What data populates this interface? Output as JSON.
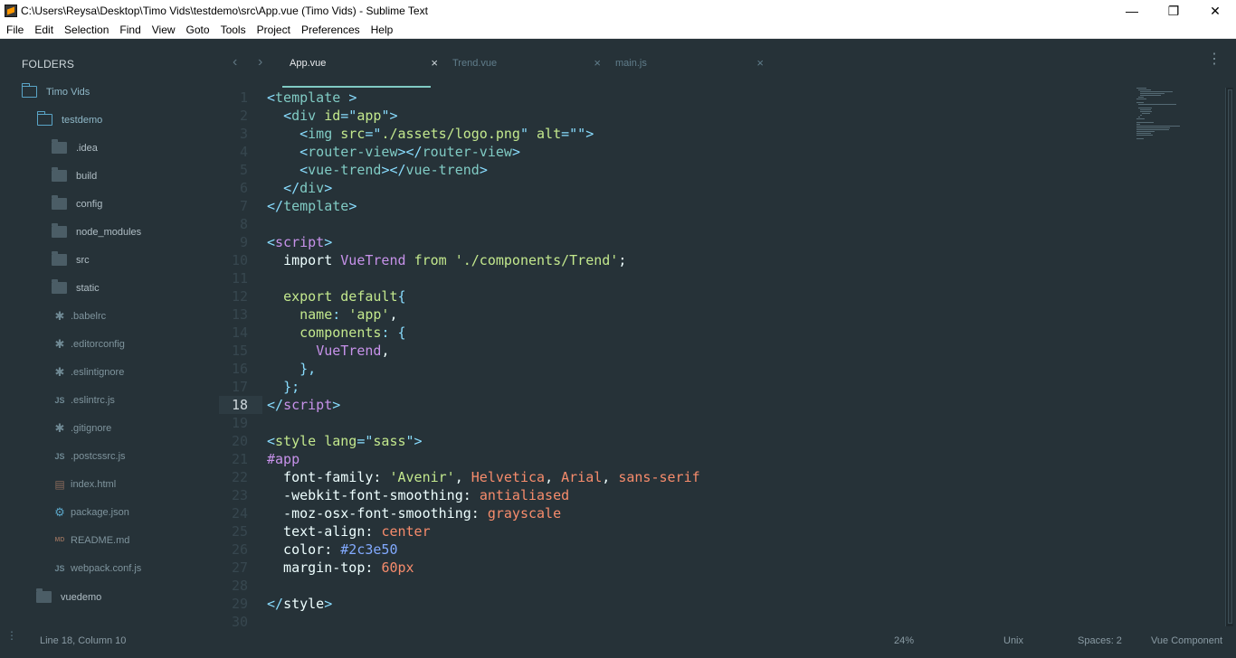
{
  "window": {
    "title": "C:\\Users\\Reysa\\Desktop\\Timo Vids\\testdemo\\src\\App.vue (Timo Vids) - Sublime Text",
    "minimize": "—",
    "maximize": "❐",
    "close": "✕"
  },
  "menu": [
    "File",
    "Edit",
    "Selection",
    "Find",
    "View",
    "Goto",
    "Tools",
    "Project",
    "Preferences",
    "Help"
  ],
  "sidebar": {
    "header": "FOLDERS",
    "root": "Timo Vids",
    "project": "testdemo",
    "folders": [
      ".idea",
      "build",
      "config",
      "node_modules",
      "src",
      "static"
    ],
    "files": [
      {
        "name": ".babelrc",
        "icon": "star",
        "glyph": "✱"
      },
      {
        "name": ".editorconfig",
        "icon": "star",
        "glyph": "✱"
      },
      {
        "name": ".eslintignore",
        "icon": "star",
        "glyph": "✱"
      },
      {
        "name": ".eslintrc.js",
        "icon": "js",
        "glyph": "JS"
      },
      {
        "name": ".gitignore",
        "icon": "star",
        "glyph": "✱"
      },
      {
        "name": ".postcssrc.js",
        "icon": "js",
        "glyph": "JS"
      },
      {
        "name": "index.html",
        "icon": "html",
        "glyph": "▤"
      },
      {
        "name": "package.json",
        "icon": "gear",
        "glyph": "⚙"
      },
      {
        "name": "README.md",
        "icon": "md",
        "glyph": "MD"
      },
      {
        "name": "webpack.conf.js",
        "icon": "js",
        "glyph": "JS"
      }
    ],
    "other_project": "vuedemo"
  },
  "tabs": {
    "back": "‹",
    "forward": "›",
    "close_glyph": "×",
    "more": "⋮",
    "items": [
      "App.vue",
      "Trend.vue",
      "main.js"
    ]
  },
  "editor": {
    "current_line": 18,
    "lines": [
      [
        [
          "t-punct",
          "<"
        ],
        [
          "t-tag",
          "template"
        ],
        [
          "t-white",
          " "
        ],
        [
          "t-punct",
          ">"
        ]
      ],
      [
        [
          "t-white",
          "  "
        ],
        [
          "t-punct",
          "<"
        ],
        [
          "t-tag",
          "div"
        ],
        [
          "t-white",
          " "
        ],
        [
          "t-attr",
          "id"
        ],
        [
          "t-punct",
          "=\""
        ],
        [
          "t-str",
          "app"
        ],
        [
          "t-punct",
          "\">"
        ]
      ],
      [
        [
          "t-white",
          "    "
        ],
        [
          "t-punct",
          "<"
        ],
        [
          "t-tag",
          "img"
        ],
        [
          "t-white",
          " "
        ],
        [
          "t-attr",
          "src"
        ],
        [
          "t-punct",
          "=\""
        ],
        [
          "t-str",
          "./assets/logo.png"
        ],
        [
          "t-punct",
          "\""
        ],
        [
          "t-white",
          " "
        ],
        [
          "t-attr",
          "alt"
        ],
        [
          "t-punct",
          "=\"\">"
        ]
      ],
      [
        [
          "t-white",
          "    "
        ],
        [
          "t-punct",
          "<"
        ],
        [
          "t-tag",
          "router-view"
        ],
        [
          "t-punct",
          "></"
        ],
        [
          "t-tag",
          "router-view"
        ],
        [
          "t-punct",
          ">"
        ]
      ],
      [
        [
          "t-white",
          "    "
        ],
        [
          "t-punct",
          "<"
        ],
        [
          "t-tag",
          "vue-trend"
        ],
        [
          "t-punct",
          "></"
        ],
        [
          "t-tag",
          "vue-trend"
        ],
        [
          "t-punct",
          ">"
        ]
      ],
      [
        [
          "t-white",
          "  "
        ],
        [
          "t-punct",
          "</"
        ],
        [
          "t-tag",
          "div"
        ],
        [
          "t-punct",
          ">"
        ]
      ],
      [
        [
          "t-punct",
          "</"
        ],
        [
          "t-tag",
          "template"
        ],
        [
          "t-punct",
          ">"
        ]
      ],
      [],
      [
        [
          "t-punct",
          "<"
        ],
        [
          "t-kw",
          "script"
        ],
        [
          "t-punct",
          ">"
        ]
      ],
      [
        [
          "t-white",
          "  "
        ],
        [
          "t-white",
          "import"
        ],
        [
          "t-white",
          " "
        ],
        [
          "t-kw",
          "VueTrend"
        ],
        [
          "t-white",
          " "
        ],
        [
          "t-attr",
          "from"
        ],
        [
          "t-white",
          " "
        ],
        [
          "t-str",
          "'./components/Trend'"
        ],
        [
          "t-white",
          ";"
        ]
      ],
      [],
      [
        [
          "t-white",
          "  "
        ],
        [
          "t-attr",
          "export"
        ],
        [
          "t-white",
          " "
        ],
        [
          "t-attr",
          "default"
        ],
        [
          "t-punct",
          "{"
        ]
      ],
      [
        [
          "t-white",
          "    "
        ],
        [
          "t-attr",
          "name"
        ],
        [
          "t-punct",
          ":"
        ],
        [
          "t-white",
          " "
        ],
        [
          "t-str",
          "'app'"
        ],
        [
          "t-white",
          ","
        ]
      ],
      [
        [
          "t-white",
          "    "
        ],
        [
          "t-attr",
          "components"
        ],
        [
          "t-punct",
          ":"
        ],
        [
          "t-white",
          " "
        ],
        [
          "t-punct",
          "{"
        ]
      ],
      [
        [
          "t-white",
          "      "
        ],
        [
          "t-kw",
          "VueTrend"
        ],
        [
          "t-white",
          ","
        ]
      ],
      [
        [
          "t-white",
          "    "
        ],
        [
          "t-punct",
          "},"
        ]
      ],
      [
        [
          "t-white",
          "  "
        ],
        [
          "t-punct",
          "};"
        ]
      ],
      [
        [
          "t-punct",
          "</"
        ],
        [
          "t-kw",
          "script"
        ],
        [
          "t-punct",
          ">"
        ]
      ],
      [],
      [
        [
          "t-punct",
          "<"
        ],
        [
          "t-attr",
          "style"
        ],
        [
          "t-white",
          " "
        ],
        [
          "t-attr",
          "lang"
        ],
        [
          "t-punct",
          "=\""
        ],
        [
          "t-str",
          "sass"
        ],
        [
          "t-punct",
          "\">"
        ]
      ],
      [
        [
          "t-kw",
          "#app"
        ]
      ],
      [
        [
          "t-white",
          "  font-family: "
        ],
        [
          "t-str",
          "'Avenir'"
        ],
        [
          "t-white",
          ", "
        ],
        [
          "t-orange",
          "Helvetica"
        ],
        [
          "t-white",
          ", "
        ],
        [
          "t-orange",
          "Arial"
        ],
        [
          "t-white",
          ", "
        ],
        [
          "t-orange",
          "sans-serif"
        ]
      ],
      [
        [
          "t-white",
          "  -webkit-font-smoothing: "
        ],
        [
          "t-orange",
          "antialiased"
        ]
      ],
      [
        [
          "t-white",
          "  -moz-osx-font-smoothing: "
        ],
        [
          "t-orange",
          "grayscale"
        ]
      ],
      [
        [
          "t-white",
          "  text-align: "
        ],
        [
          "t-orange",
          "center"
        ]
      ],
      [
        [
          "t-white",
          "  color: "
        ],
        [
          "t-var",
          "#2c3e50"
        ]
      ],
      [
        [
          "t-white",
          "  margin-top: "
        ],
        [
          "t-orange",
          "60px"
        ]
      ],
      [],
      [
        [
          "t-punct",
          "</"
        ],
        [
          "t-white",
          "style"
        ],
        [
          "t-punct",
          ">"
        ]
      ],
      []
    ]
  },
  "status": {
    "position": "Line 18, Column 10",
    "zoom": "24%",
    "line_endings": "Unix",
    "indent": "Spaces: 2",
    "syntax": "Vue Component",
    "grip": "⋮"
  }
}
